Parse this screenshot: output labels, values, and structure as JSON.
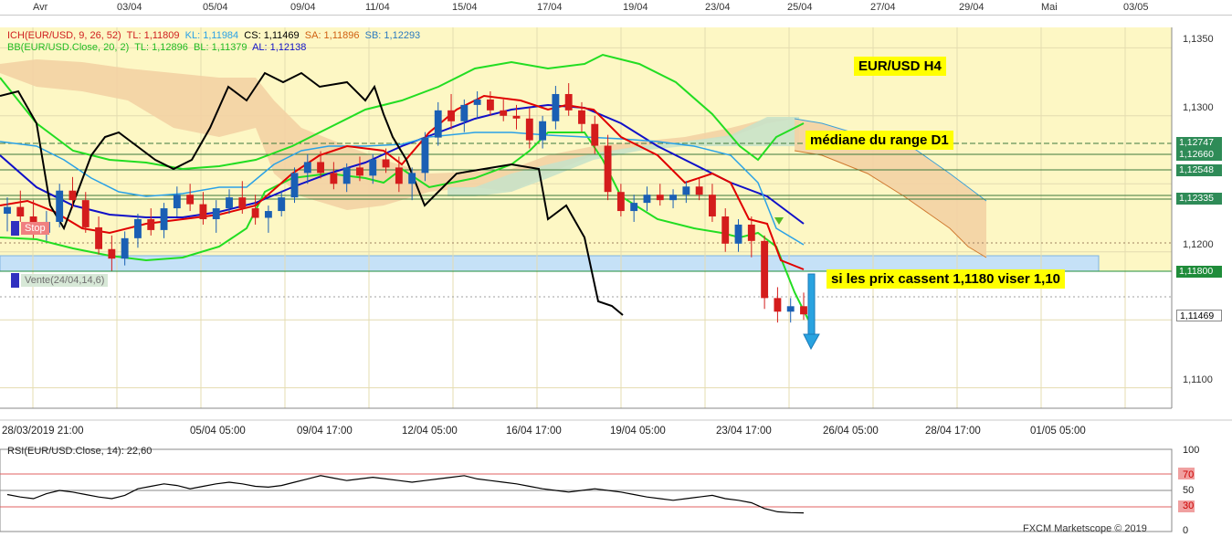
{
  "top_axis": [
    "Avr",
    "03/04",
    "05/04",
    "09/04",
    "11/04",
    "15/04",
    "17/04",
    "19/04",
    "23/04",
    "25/04",
    "27/04",
    "29/04",
    "Mai",
    "03/05"
  ],
  "bottom_axis": [
    "28/03/2019 21:00",
    "05/04 05:00",
    "09/04 17:00",
    "12/04 05:00",
    "16/04 17:00",
    "19/04 05:00",
    "23/04 17:00",
    "26/04 05:00",
    "28/04 17:00",
    "01/05 05:00"
  ],
  "legend": {
    "ich_name": "ICH(EUR/USD, 9, 26, 52)",
    "ich_tl": "TL: 1,11809",
    "ich_kl": "KL: 1,11984",
    "ich_cs": "CS: 1,11469",
    "ich_sa": "SA: 1,11896",
    "ich_sb": "SB: 1,12293",
    "bb_name": "BB(EUR/USD.Close, 20, 2)",
    "bb_tl": "TL: 1,12896",
    "bb_bl": "BL: 1,11379",
    "bb_al": "AL: 1,12138"
  },
  "annotations": {
    "title": "EUR/USD H4",
    "mediane": "médiane du range D1",
    "break": "si les prix cassent 1,1180 viser 1,10",
    "stop": "Stop",
    "vente": "Vente(24/04,14,6)"
  },
  "price_axis": [
    "1,1350",
    "1,1300",
    "1,1200",
    "1,1100"
  ],
  "right_tags": [
    {
      "text": "1,12747",
      "color": "#2e8b57"
    },
    {
      "text": "1,12660",
      "color": "#2e8b57"
    },
    {
      "text": "1,12548",
      "color": "#2e8b57"
    },
    {
      "text": "1,12335",
      "color": "#2e8b57"
    },
    {
      "text": "1,11800",
      "color": "#1f8c3a"
    },
    {
      "text": "1,11469",
      "color": "#ffffff"
    }
  ],
  "rsi": {
    "label": "RSI(EUR/USD.Close, 14): 22,60",
    "levels": [
      "100",
      "70",
      "50",
      "30",
      "0"
    ]
  },
  "footer": "FXCM Marketscope © 2019",
  "colors": {
    "plot_bg": "#fdf7c4",
    "cloud_bull": "#f3d1a4",
    "cloud_bear": "#c9e2c9",
    "tenkan": "#e00000",
    "kijun": "#2aa1e6",
    "chikou": "#000000",
    "bollinger": "#22dd22",
    "bb_mid": "#1010c8",
    "zone": "#c5e1f7",
    "arrow": "#29a3e0"
  },
  "chart_data": {
    "type": "candlestick",
    "symbol": "EUR/USD",
    "timeframe": "H4",
    "ylim": [
      1.1085,
      1.1365
    ],
    "horizontal_levels": [
      1.12747,
      1.1266,
      1.12548,
      1.12335,
      1.118,
      1.11469
    ],
    "candles": [
      {
        "o": 1.1228,
        "h": 1.124,
        "l": 1.1215,
        "c": 1.1233
      },
      {
        "o": 1.1233,
        "h": 1.1245,
        "l": 1.1222,
        "c": 1.1226
      },
      {
        "o": 1.1226,
        "h": 1.1238,
        "l": 1.121,
        "c": 1.1214
      },
      {
        "o": 1.1214,
        "h": 1.123,
        "l": 1.1208,
        "c": 1.1222
      },
      {
        "o": 1.1222,
        "h": 1.125,
        "l": 1.1218,
        "c": 1.1245
      },
      {
        "o": 1.1245,
        "h": 1.1255,
        "l": 1.1232,
        "c": 1.1238
      },
      {
        "o": 1.1238,
        "h": 1.1244,
        "l": 1.1214,
        "c": 1.1218
      },
      {
        "o": 1.1218,
        "h": 1.1226,
        "l": 1.1198,
        "c": 1.1202
      },
      {
        "o": 1.1202,
        "h": 1.1212,
        "l": 1.1186,
        "c": 1.1195
      },
      {
        "o": 1.1195,
        "h": 1.1215,
        "l": 1.119,
        "c": 1.121
      },
      {
        "o": 1.121,
        "h": 1.1228,
        "l": 1.1203,
        "c": 1.1224
      },
      {
        "o": 1.1224,
        "h": 1.1232,
        "l": 1.1212,
        "c": 1.1216
      },
      {
        "o": 1.1216,
        "h": 1.1236,
        "l": 1.121,
        "c": 1.1232
      },
      {
        "o": 1.1232,
        "h": 1.1248,
        "l": 1.1226,
        "c": 1.1242
      },
      {
        "o": 1.1242,
        "h": 1.125,
        "l": 1.123,
        "c": 1.1235
      },
      {
        "o": 1.1235,
        "h": 1.1244,
        "l": 1.122,
        "c": 1.1224
      },
      {
        "o": 1.1224,
        "h": 1.1238,
        "l": 1.1214,
        "c": 1.1232
      },
      {
        "o": 1.1232,
        "h": 1.1246,
        "l": 1.1228,
        "c": 1.124
      },
      {
        "o": 1.124,
        "h": 1.1252,
        "l": 1.1228,
        "c": 1.1232
      },
      {
        "o": 1.1232,
        "h": 1.1242,
        "l": 1.122,
        "c": 1.1225
      },
      {
        "o": 1.1225,
        "h": 1.1234,
        "l": 1.1214,
        "c": 1.123
      },
      {
        "o": 1.123,
        "h": 1.1245,
        "l": 1.1226,
        "c": 1.124
      },
      {
        "o": 1.124,
        "h": 1.1262,
        "l": 1.1236,
        "c": 1.1258
      },
      {
        "o": 1.1258,
        "h": 1.1272,
        "l": 1.125,
        "c": 1.1266
      },
      {
        "o": 1.1266,
        "h": 1.1274,
        "l": 1.1254,
        "c": 1.1258
      },
      {
        "o": 1.1258,
        "h": 1.1266,
        "l": 1.1246,
        "c": 1.125
      },
      {
        "o": 1.125,
        "h": 1.1265,
        "l": 1.1244,
        "c": 1.1262
      },
      {
        "o": 1.1262,
        "h": 1.127,
        "l": 1.1252,
        "c": 1.1256
      },
      {
        "o": 1.1256,
        "h": 1.1272,
        "l": 1.125,
        "c": 1.1268
      },
      {
        "o": 1.1268,
        "h": 1.1276,
        "l": 1.1258,
        "c": 1.1262
      },
      {
        "o": 1.1262,
        "h": 1.127,
        "l": 1.1244,
        "c": 1.125
      },
      {
        "o": 1.125,
        "h": 1.1262,
        "l": 1.1238,
        "c": 1.1258
      },
      {
        "o": 1.1258,
        "h": 1.1288,
        "l": 1.1252,
        "c": 1.1284
      },
      {
        "o": 1.1284,
        "h": 1.131,
        "l": 1.1278,
        "c": 1.1304
      },
      {
        "o": 1.1304,
        "h": 1.1316,
        "l": 1.129,
        "c": 1.1296
      },
      {
        "o": 1.1296,
        "h": 1.1312,
        "l": 1.1288,
        "c": 1.1308
      },
      {
        "o": 1.1308,
        "h": 1.1318,
        "l": 1.1298,
        "c": 1.1312
      },
      {
        "o": 1.1312,
        "h": 1.1318,
        "l": 1.13,
        "c": 1.1304
      },
      {
        "o": 1.1304,
        "h": 1.1312,
        "l": 1.1296,
        "c": 1.13
      },
      {
        "o": 1.13,
        "h": 1.1308,
        "l": 1.129,
        "c": 1.1298
      },
      {
        "o": 1.1298,
        "h": 1.1306,
        "l": 1.1276,
        "c": 1.1282
      },
      {
        "o": 1.1282,
        "h": 1.13,
        "l": 1.1276,
        "c": 1.1296
      },
      {
        "o": 1.1296,
        "h": 1.1322,
        "l": 1.129,
        "c": 1.1316
      },
      {
        "o": 1.1316,
        "h": 1.1324,
        "l": 1.13,
        "c": 1.1304
      },
      {
        "o": 1.1304,
        "h": 1.131,
        "l": 1.1288,
        "c": 1.1294
      },
      {
        "o": 1.1294,
        "h": 1.13,
        "l": 1.1272,
        "c": 1.1278
      },
      {
        "o": 1.1278,
        "h": 1.1286,
        "l": 1.1238,
        "c": 1.1244
      },
      {
        "o": 1.1244,
        "h": 1.125,
        "l": 1.1226,
        "c": 1.123
      },
      {
        "o": 1.123,
        "h": 1.1242,
        "l": 1.1222,
        "c": 1.1236
      },
      {
        "o": 1.1236,
        "h": 1.1248,
        "l": 1.123,
        "c": 1.1242
      },
      {
        "o": 1.1242,
        "h": 1.125,
        "l": 1.1234,
        "c": 1.1238
      },
      {
        "o": 1.1238,
        "h": 1.1246,
        "l": 1.1232,
        "c": 1.1242
      },
      {
        "o": 1.1242,
        "h": 1.1252,
        "l": 1.1236,
        "c": 1.1248
      },
      {
        "o": 1.1248,
        "h": 1.1254,
        "l": 1.1238,
        "c": 1.1242
      },
      {
        "o": 1.1242,
        "h": 1.125,
        "l": 1.1222,
        "c": 1.1226
      },
      {
        "o": 1.1226,
        "h": 1.1232,
        "l": 1.12,
        "c": 1.1206
      },
      {
        "o": 1.1206,
        "h": 1.1224,
        "l": 1.12,
        "c": 1.122
      },
      {
        "o": 1.122,
        "h": 1.1226,
        "l": 1.1196,
        "c": 1.1208
      },
      {
        "o": 1.1208,
        "h": 1.1212,
        "l": 1.1158,
        "c": 1.1166
      },
      {
        "o": 1.1166,
        "h": 1.1174,
        "l": 1.1148,
        "c": 1.1156
      },
      {
        "o": 1.1156,
        "h": 1.1166,
        "l": 1.1148,
        "c": 1.116
      },
      {
        "o": 1.116,
        "h": 1.117,
        "l": 1.115,
        "c": 1.1154
      }
    ],
    "rsi": [
      45,
      42,
      40,
      46,
      50,
      48,
      45,
      42,
      40,
      44,
      52,
      55,
      58,
      56,
      52,
      55,
      58,
      60,
      58,
      55,
      54,
      56,
      60,
      64,
      68,
      65,
      62,
      64,
      66,
      64,
      62,
      60,
      62,
      64,
      66,
      68,
      64,
      62,
      60,
      58,
      55,
      52,
      50,
      48,
      50,
      52,
      50,
      48,
      45,
      42,
      40,
      38,
      40,
      42,
      44,
      40,
      38,
      35,
      28,
      24,
      23,
      22.6
    ]
  }
}
